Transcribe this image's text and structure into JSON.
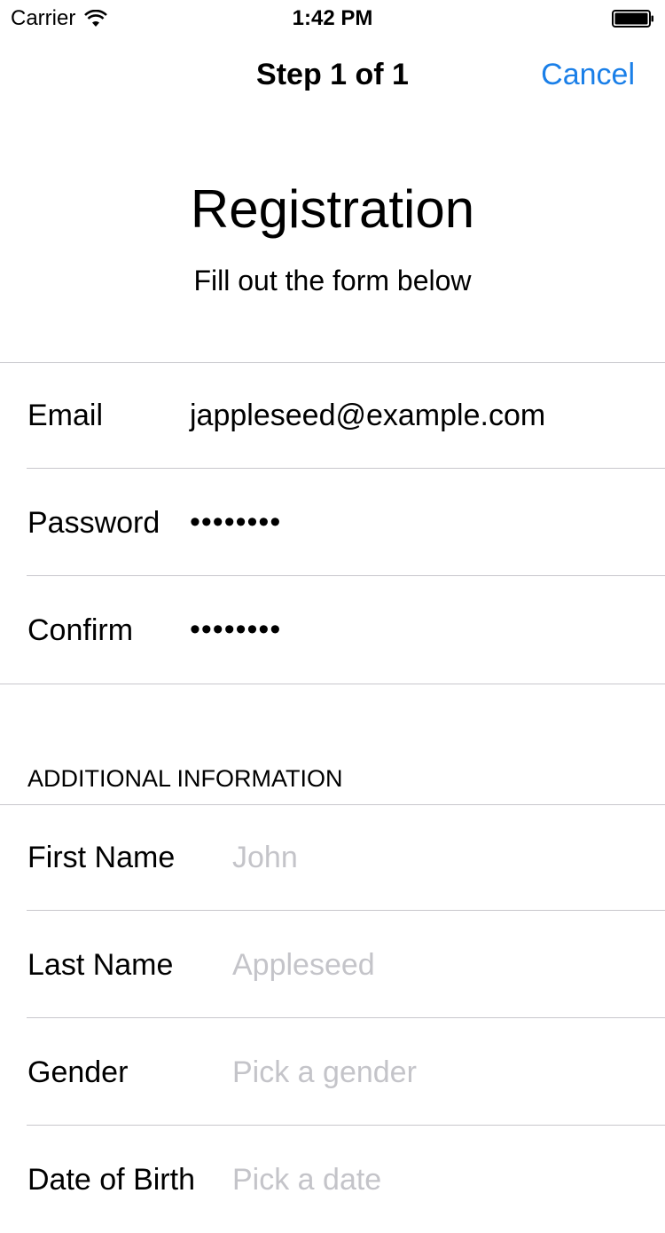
{
  "status_bar": {
    "carrier": "Carrier",
    "time": "1:42 PM"
  },
  "nav": {
    "title": "Step 1 of 1",
    "cancel_label": "Cancel"
  },
  "header": {
    "title": "Registration",
    "subtitle": "Fill out the form below"
  },
  "account": {
    "rows": [
      {
        "label": "Email",
        "value": "jappleseed@example.com"
      },
      {
        "label": "Password",
        "value": "••••••••"
      },
      {
        "label": "Confirm",
        "value": "••••••••"
      }
    ]
  },
  "additional": {
    "header": "ADDITIONAL INFORMATION",
    "rows": [
      {
        "label": "First Name",
        "placeholder": "John"
      },
      {
        "label": "Last Name",
        "placeholder": "Appleseed"
      },
      {
        "label": "Gender",
        "placeholder": "Pick a gender"
      },
      {
        "label": "Date of Birth",
        "placeholder": "Pick a date"
      }
    ]
  },
  "colors": {
    "accent": "#1a7fe8",
    "placeholder": "#c4c4c9",
    "separator": "#c8c7cc"
  }
}
